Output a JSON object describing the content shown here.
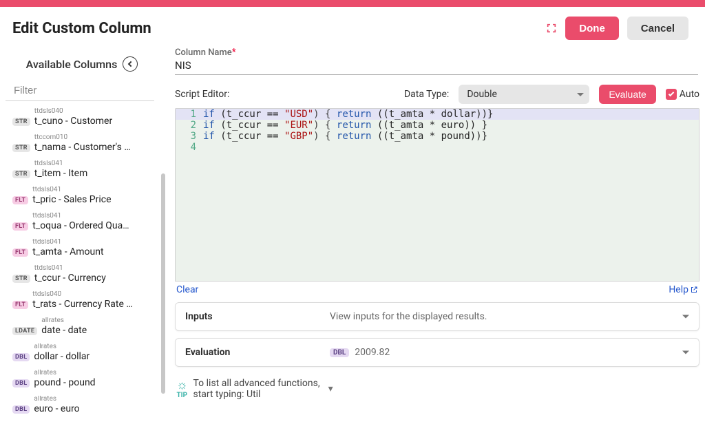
{
  "header": {
    "title": "Edit Custom Column",
    "done_label": "Done",
    "cancel_label": "Cancel"
  },
  "column_name": {
    "label": "Column Name",
    "required_mark": "*",
    "value": "NIS"
  },
  "left": {
    "title": "Available Columns",
    "filter_placeholder": "Filter",
    "columns": [
      {
        "type": "STR",
        "source": "ttdsls040",
        "label": "t_cuno - Customer"
      },
      {
        "type": "STR",
        "source": "ttccom010",
        "label": "t_nama - Customer's …"
      },
      {
        "type": "STR",
        "source": "ttdsls041",
        "label": "t_item - Item"
      },
      {
        "type": "FLT",
        "source": "ttdsls041",
        "label": "t_pric - Sales Price"
      },
      {
        "type": "FLT",
        "source": "ttdsls041",
        "label": "t_oqua - Ordered Qua…"
      },
      {
        "type": "FLT",
        "source": "ttdsls041",
        "label": "t_amta - Amount"
      },
      {
        "type": "STR",
        "source": "ttdsls041",
        "label": "t_ccur - Currency"
      },
      {
        "type": "FLT",
        "source": "ttdsls040",
        "label": "t_rats - Currency Rate …"
      },
      {
        "type": "LDATE",
        "source": "allrates",
        "label": "date - date"
      },
      {
        "type": "DBL",
        "source": "allrates",
        "label": "dollar - dollar"
      },
      {
        "type": "DBL",
        "source": "allrates",
        "label": "pound - pound"
      },
      {
        "type": "DBL",
        "source": "allrates",
        "label": "euro - euro"
      }
    ]
  },
  "editor": {
    "label": "Script Editor:",
    "data_type_label": "Data Type:",
    "data_type_value": "Double",
    "evaluate_label": "Evaluate",
    "auto_label": "Auto",
    "lines": [
      {
        "n": "1",
        "kw1": "if",
        "open": " (t_ccur == ",
        "str": "\"USD\"",
        "mid": ") { ",
        "kw2": "return",
        "rest": " ((t_amta * dollar))}"
      },
      {
        "n": "2",
        "kw1": "if",
        "open": " (t_ccur == ",
        "str": "\"EUR\"",
        "mid": ") { ",
        "kw2": "return",
        "rest": " ((t_amta * euro)) }"
      },
      {
        "n": "3",
        "kw1": "if",
        "open": " (t_ccur == ",
        "str": "\"GBP\"",
        "mid": ") { ",
        "kw2": "return",
        "rest": " ((t_amta * pound))}"
      },
      {
        "n": "4",
        "kw1": "",
        "open": "",
        "str": "",
        "mid": "",
        "kw2": "",
        "rest": ""
      }
    ],
    "clear_label": "Clear",
    "help_label": "Help"
  },
  "inputs_panel": {
    "title": "Inputs",
    "hint": "View inputs for the displayed results."
  },
  "evaluation_panel": {
    "title": "Evaluation",
    "badge": "DBL",
    "value": "2009.82"
  },
  "tip": {
    "label": "TIP",
    "line1": "To list all advanced functions,",
    "line2": "start typing: Util"
  }
}
